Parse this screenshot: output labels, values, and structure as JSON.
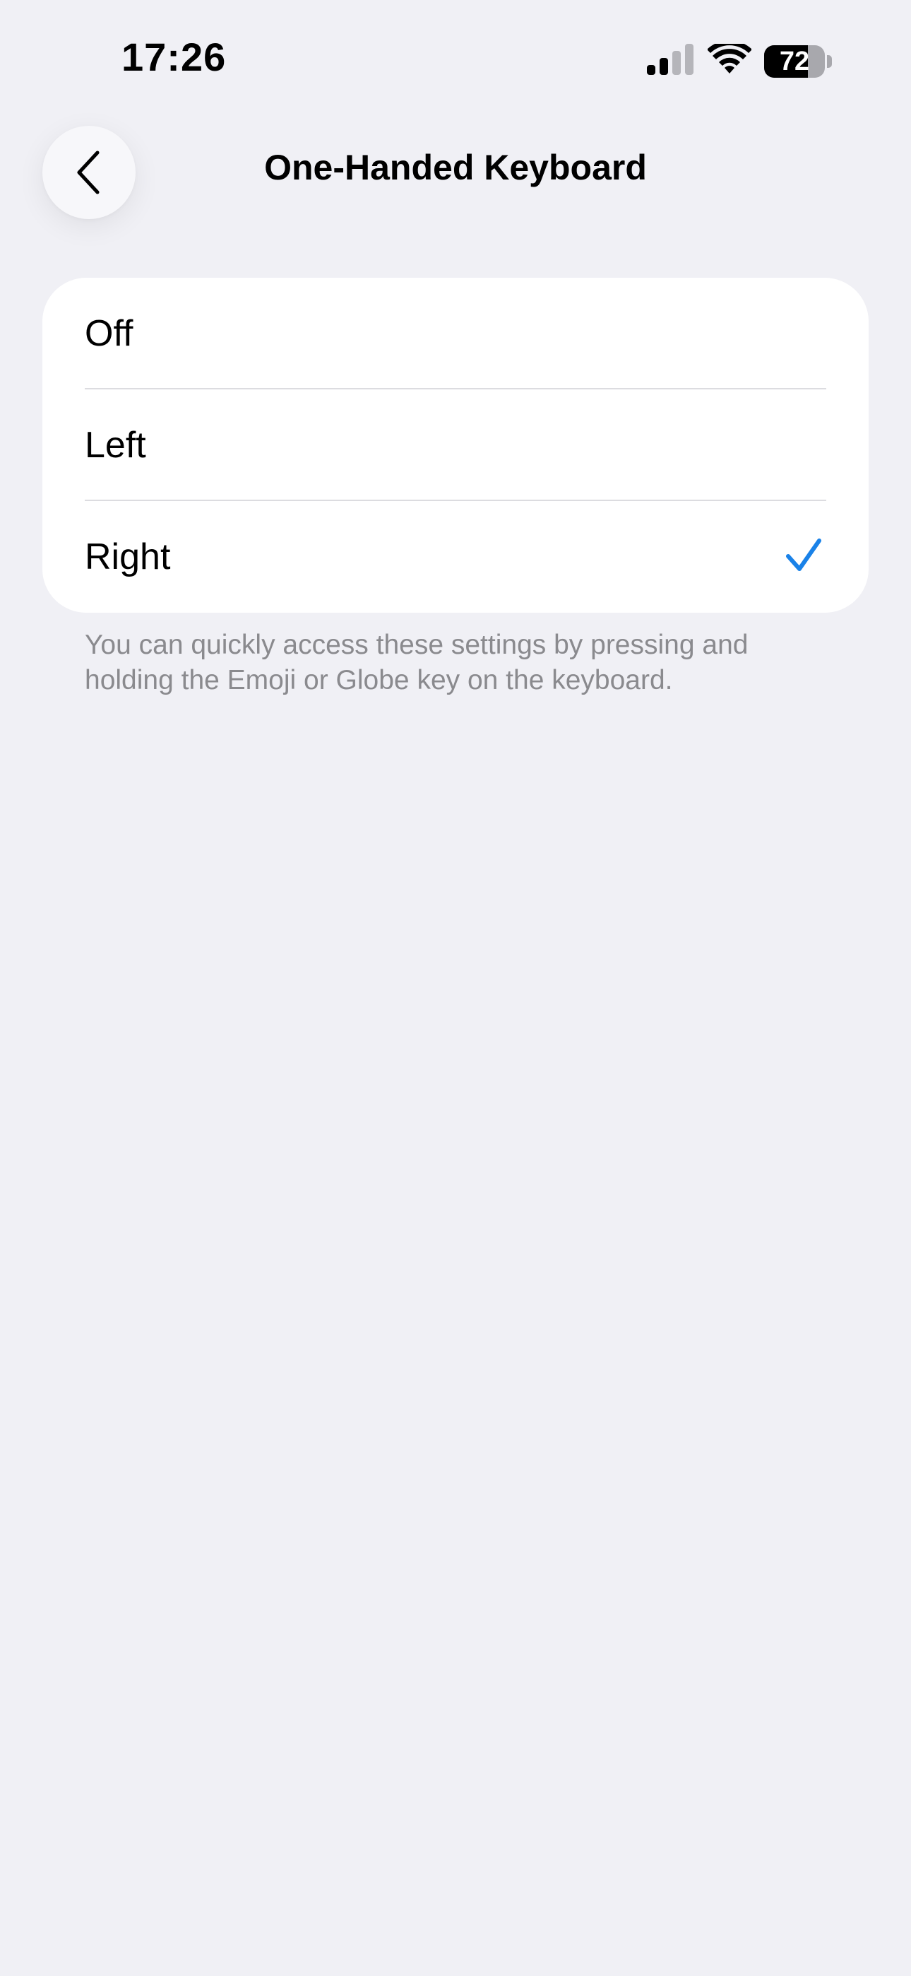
{
  "status_bar": {
    "time": "17:26",
    "battery_level": "72",
    "battery_fraction": 0.72,
    "signal_icon": "cellular-signal-icon",
    "wifi_icon": "wifi-icon"
  },
  "nav": {
    "back_icon": "chevron-left-icon",
    "title": "One-Handed Keyboard"
  },
  "options": [
    {
      "label": "Off",
      "selected": false
    },
    {
      "label": "Left",
      "selected": false
    },
    {
      "label": "Right",
      "selected": true
    }
  ],
  "footer": {
    "note": "You can quickly access these settings by pressing and holding the Emoji or Globe key on the keyboard."
  },
  "colors": {
    "background": "#f0f0f5",
    "card": "#ffffff",
    "accent": "#1a82e8",
    "secondary_text": "#8a8a8e"
  }
}
